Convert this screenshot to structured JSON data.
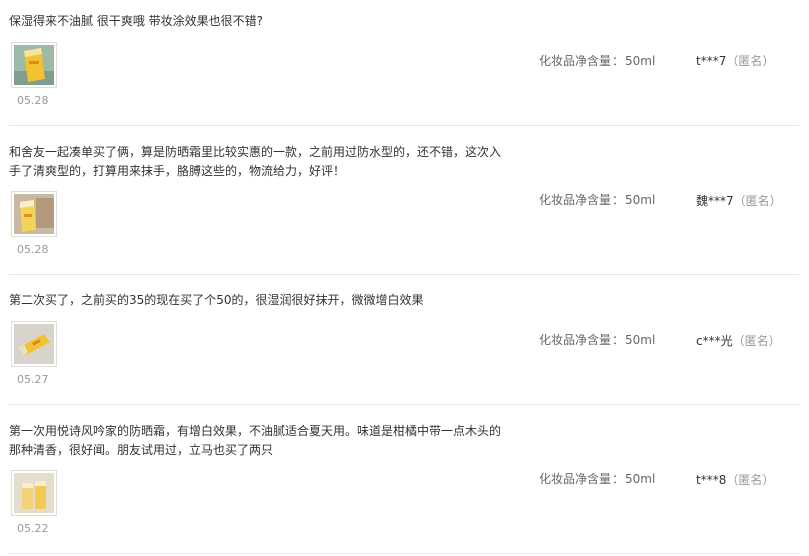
{
  "reviews": [
    {
      "content": "保湿得来不油腻 很干爽哦 带妆涂效果也很不错?",
      "date": "05.28",
      "spec_label": "化妆品净含量",
      "spec_value": "50ml",
      "user": "t***7",
      "anon": "（匿名）"
    },
    {
      "content": "和舍友一起凑单买了俩，算是防晒霜里比较实惠的一款，之前用过防水型的，还不错，这次入手了清爽型的，打算用来抹手，胳膊这些的，物流给力，好评！",
      "date": "05.28",
      "spec_label": "化妆品净含量",
      "spec_value": "50ml",
      "user": "魏***7",
      "anon": "（匿名）"
    },
    {
      "content": "第二次买了，之前买的35的现在买了个50的，很湿润很好抹开，微微增白效果",
      "date": "05.27",
      "spec_label": "化妆品净含量",
      "spec_value": "50ml",
      "user": "c***光",
      "anon": "（匿名）"
    },
    {
      "content": "第一次用悦诗风吟家的防晒霜，有增白效果，不油腻适合夏天用。味道是柑橘中带一点木头的那种清香，很好闻。朋友试用过，立马也买了两只",
      "date": "05.22",
      "spec_label": "化妆品净含量",
      "spec_value": "50ml",
      "user": "t***8",
      "anon": "（匿名）"
    }
  ],
  "colors": {
    "text": "#333333",
    "muted": "#999999",
    "divider": "#e6e6e6",
    "product_yellow": "#f2c230"
  },
  "icons": [
    "product-thumbnail-image"
  ]
}
